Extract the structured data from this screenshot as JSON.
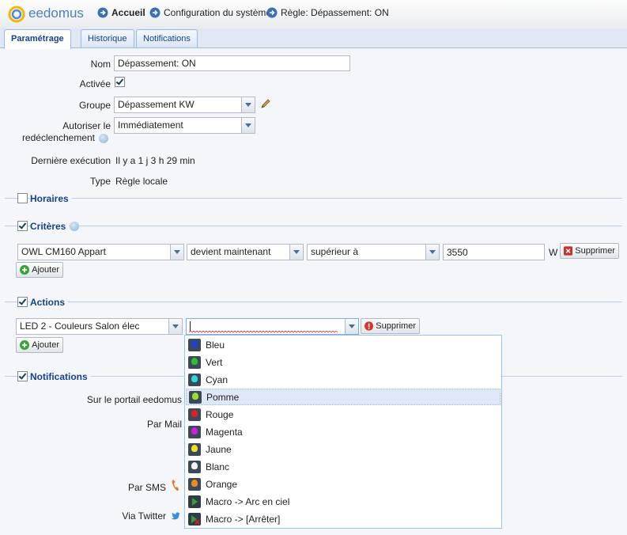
{
  "header": {
    "logo_text": "eedomus",
    "breadcrumbs": [
      "Accueil",
      "Configuration du système",
      "Règle: Dépassement: ON"
    ]
  },
  "tabs": [
    "Paramétrage",
    "Historique",
    "Notifications"
  ],
  "form": {
    "nom_label": "Nom",
    "nom_value": "Dépassement: ON",
    "activee_label": "Activée",
    "groupe_label": "Groupe",
    "groupe_value": "Dépassement KW",
    "autoriser_label_1": "Autoriser le",
    "autoriser_label_2": "redéclenchement",
    "autoriser_value": "Immédiatement",
    "derniere_label": "Dernière exécution",
    "derniere_value": "Il y a 1 j 3 h 29 min",
    "type_label": "Type",
    "type_value": "Règle locale"
  },
  "sections": {
    "horaires": "Horaires",
    "criteres": "Critères",
    "actions": "Actions",
    "notifications": "Notifications"
  },
  "criteres": {
    "device": "OWL CM160 Appart",
    "condition": "devient maintenant",
    "operator": "supérieur à",
    "value": "3550",
    "unit": "W",
    "delete_label": "Supprimer",
    "add_label": "Ajouter"
  },
  "actions": {
    "device": "LED 2 - Couleurs Salon élec",
    "value": "",
    "delete_label": "Supprimer",
    "add_label": "Ajouter"
  },
  "notifications": {
    "portail_label": "Sur le portail eedomus",
    "mail_label": "Par Mail",
    "sms_label": "Par SMS",
    "twitter_label": "Via Twitter"
  },
  "dropdown": {
    "selected": "Pomme",
    "options": [
      {
        "label": "Bleu",
        "color": "#1f3fd8"
      },
      {
        "label": "Vert",
        "color": "#2fc02f"
      },
      {
        "label": "Cyan",
        "color": "#2fd8e0"
      },
      {
        "label": "Pomme",
        "color": "#9be02a"
      },
      {
        "label": "Rouge",
        "color": "#e02020"
      },
      {
        "label": "Magenta",
        "color": "#d020d8"
      },
      {
        "label": "Jaune",
        "color": "#f0e020"
      },
      {
        "label": "Blanc",
        "color": "#f4f4f4"
      },
      {
        "label": "Orange",
        "color": "#f08a20"
      },
      {
        "label": "Macro -> Arc en ciel",
        "color": "#3a9a3a"
      },
      {
        "label": "Macro -> [Arrêter]",
        "color": "#d02020"
      }
    ]
  }
}
